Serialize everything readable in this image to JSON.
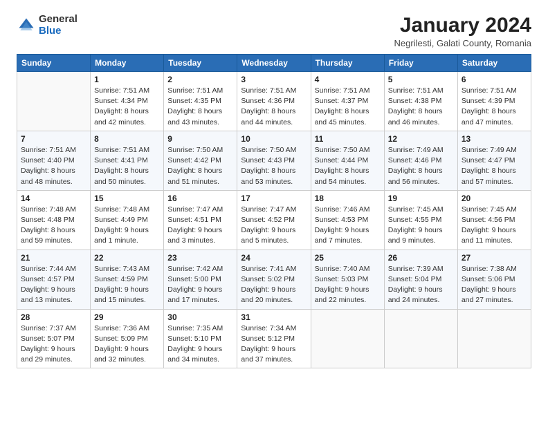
{
  "logo": {
    "general": "General",
    "blue": "Blue"
  },
  "title": "January 2024",
  "subtitle": "Negrilesti, Galati County, Romania",
  "weekdays": [
    "Sunday",
    "Monday",
    "Tuesday",
    "Wednesday",
    "Thursday",
    "Friday",
    "Saturday"
  ],
  "weeks": [
    [
      {
        "day": "",
        "info": ""
      },
      {
        "day": "1",
        "info": "Sunrise: 7:51 AM\nSunset: 4:34 PM\nDaylight: 8 hours\nand 42 minutes."
      },
      {
        "day": "2",
        "info": "Sunrise: 7:51 AM\nSunset: 4:35 PM\nDaylight: 8 hours\nand 43 minutes."
      },
      {
        "day": "3",
        "info": "Sunrise: 7:51 AM\nSunset: 4:36 PM\nDaylight: 8 hours\nand 44 minutes."
      },
      {
        "day": "4",
        "info": "Sunrise: 7:51 AM\nSunset: 4:37 PM\nDaylight: 8 hours\nand 45 minutes."
      },
      {
        "day": "5",
        "info": "Sunrise: 7:51 AM\nSunset: 4:38 PM\nDaylight: 8 hours\nand 46 minutes."
      },
      {
        "day": "6",
        "info": "Sunrise: 7:51 AM\nSunset: 4:39 PM\nDaylight: 8 hours\nand 47 minutes."
      }
    ],
    [
      {
        "day": "7",
        "info": "Sunrise: 7:51 AM\nSunset: 4:40 PM\nDaylight: 8 hours\nand 48 minutes."
      },
      {
        "day": "8",
        "info": "Sunrise: 7:51 AM\nSunset: 4:41 PM\nDaylight: 8 hours\nand 50 minutes."
      },
      {
        "day": "9",
        "info": "Sunrise: 7:50 AM\nSunset: 4:42 PM\nDaylight: 8 hours\nand 51 minutes."
      },
      {
        "day": "10",
        "info": "Sunrise: 7:50 AM\nSunset: 4:43 PM\nDaylight: 8 hours\nand 53 minutes."
      },
      {
        "day": "11",
        "info": "Sunrise: 7:50 AM\nSunset: 4:44 PM\nDaylight: 8 hours\nand 54 minutes."
      },
      {
        "day": "12",
        "info": "Sunrise: 7:49 AM\nSunset: 4:46 PM\nDaylight: 8 hours\nand 56 minutes."
      },
      {
        "day": "13",
        "info": "Sunrise: 7:49 AM\nSunset: 4:47 PM\nDaylight: 8 hours\nand 57 minutes."
      }
    ],
    [
      {
        "day": "14",
        "info": "Sunrise: 7:48 AM\nSunset: 4:48 PM\nDaylight: 8 hours\nand 59 minutes."
      },
      {
        "day": "15",
        "info": "Sunrise: 7:48 AM\nSunset: 4:49 PM\nDaylight: 9 hours\nand 1 minute."
      },
      {
        "day": "16",
        "info": "Sunrise: 7:47 AM\nSunset: 4:51 PM\nDaylight: 9 hours\nand 3 minutes."
      },
      {
        "day": "17",
        "info": "Sunrise: 7:47 AM\nSunset: 4:52 PM\nDaylight: 9 hours\nand 5 minutes."
      },
      {
        "day": "18",
        "info": "Sunrise: 7:46 AM\nSunset: 4:53 PM\nDaylight: 9 hours\nand 7 minutes."
      },
      {
        "day": "19",
        "info": "Sunrise: 7:45 AM\nSunset: 4:55 PM\nDaylight: 9 hours\nand 9 minutes."
      },
      {
        "day": "20",
        "info": "Sunrise: 7:45 AM\nSunset: 4:56 PM\nDaylight: 9 hours\nand 11 minutes."
      }
    ],
    [
      {
        "day": "21",
        "info": "Sunrise: 7:44 AM\nSunset: 4:57 PM\nDaylight: 9 hours\nand 13 minutes."
      },
      {
        "day": "22",
        "info": "Sunrise: 7:43 AM\nSunset: 4:59 PM\nDaylight: 9 hours\nand 15 minutes."
      },
      {
        "day": "23",
        "info": "Sunrise: 7:42 AM\nSunset: 5:00 PM\nDaylight: 9 hours\nand 17 minutes."
      },
      {
        "day": "24",
        "info": "Sunrise: 7:41 AM\nSunset: 5:02 PM\nDaylight: 9 hours\nand 20 minutes."
      },
      {
        "day": "25",
        "info": "Sunrise: 7:40 AM\nSunset: 5:03 PM\nDaylight: 9 hours\nand 22 minutes."
      },
      {
        "day": "26",
        "info": "Sunrise: 7:39 AM\nSunset: 5:04 PM\nDaylight: 9 hours\nand 24 minutes."
      },
      {
        "day": "27",
        "info": "Sunrise: 7:38 AM\nSunset: 5:06 PM\nDaylight: 9 hours\nand 27 minutes."
      }
    ],
    [
      {
        "day": "28",
        "info": "Sunrise: 7:37 AM\nSunset: 5:07 PM\nDaylight: 9 hours\nand 29 minutes."
      },
      {
        "day": "29",
        "info": "Sunrise: 7:36 AM\nSunset: 5:09 PM\nDaylight: 9 hours\nand 32 minutes."
      },
      {
        "day": "30",
        "info": "Sunrise: 7:35 AM\nSunset: 5:10 PM\nDaylight: 9 hours\nand 34 minutes."
      },
      {
        "day": "31",
        "info": "Sunrise: 7:34 AM\nSunset: 5:12 PM\nDaylight: 9 hours\nand 37 minutes."
      },
      {
        "day": "",
        "info": ""
      },
      {
        "day": "",
        "info": ""
      },
      {
        "day": "",
        "info": ""
      }
    ]
  ]
}
